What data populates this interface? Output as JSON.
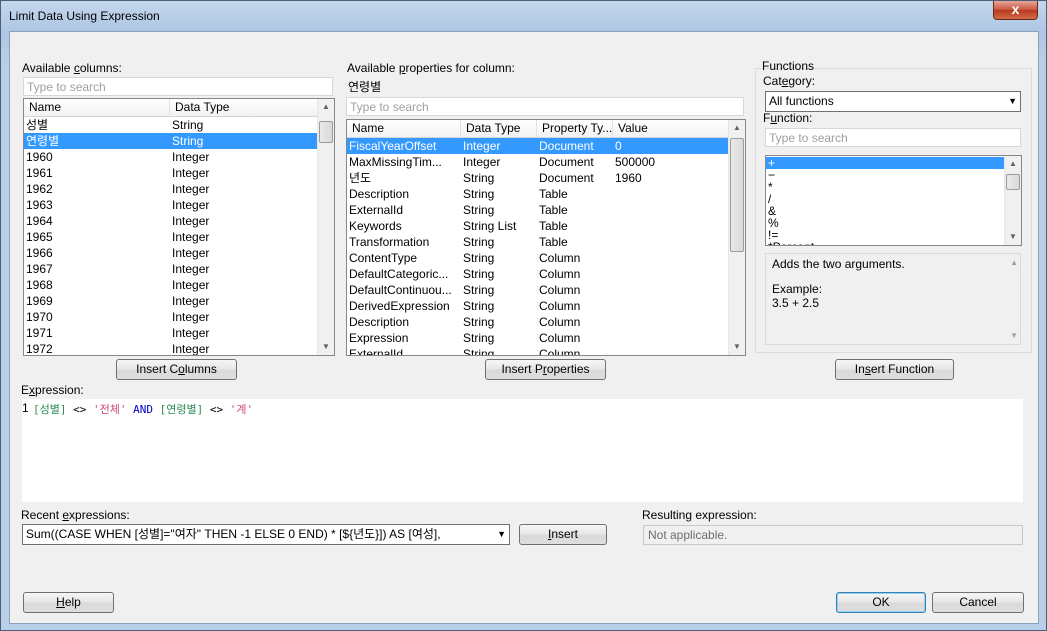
{
  "window": {
    "title": "Limit Data Using Expression",
    "close_glyph": "x"
  },
  "available_columns": {
    "label_pre": "Available ",
    "label_u": "c",
    "label_post": "olumns:",
    "search_placeholder": "Type to search",
    "headers": [
      "Name",
      "Data Type"
    ],
    "rows": [
      [
        "성별",
        "String"
      ],
      [
        "연령별",
        "String"
      ],
      [
        "1960",
        "Integer"
      ],
      [
        "1961",
        "Integer"
      ],
      [
        "1962",
        "Integer"
      ],
      [
        "1963",
        "Integer"
      ],
      [
        "1964",
        "Integer"
      ],
      [
        "1965",
        "Integer"
      ],
      [
        "1966",
        "Integer"
      ],
      [
        "1967",
        "Integer"
      ],
      [
        "1968",
        "Integer"
      ],
      [
        "1969",
        "Integer"
      ],
      [
        "1970",
        "Integer"
      ],
      [
        "1971",
        "Integer"
      ],
      [
        "1972",
        "Integer"
      ]
    ],
    "selected_index": 1,
    "insert_pre": "Insert C",
    "insert_u": "o",
    "insert_post": "lumns"
  },
  "available_properties": {
    "label_pre": "Available ",
    "label_u": "p",
    "label_post": "roperties for column:",
    "column_name": "연령별",
    "search_placeholder": "Type to search",
    "headers": [
      "Name",
      "Data Type",
      "Property Ty...",
      "Value"
    ],
    "rows": [
      [
        "FiscalYearOffset",
        "Integer",
        "Document",
        "0"
      ],
      [
        "MaxMissingTim...",
        "Integer",
        "Document",
        "500000"
      ],
      [
        "년도",
        "String",
        "Document",
        "1960"
      ],
      [
        "Description",
        "String",
        "Table",
        ""
      ],
      [
        "ExternalId",
        "String",
        "Table",
        ""
      ],
      [
        "Keywords",
        "String List",
        "Table",
        ""
      ],
      [
        "Transformation",
        "String",
        "Table",
        ""
      ],
      [
        "ContentType",
        "String",
        "Column",
        ""
      ],
      [
        "DefaultCategoric...",
        "String",
        "Column",
        ""
      ],
      [
        "DefaultContinuou...",
        "String",
        "Column",
        ""
      ],
      [
        "DerivedExpression",
        "String",
        "Column",
        ""
      ],
      [
        "Description",
        "String",
        "Column",
        ""
      ],
      [
        "Expression",
        "String",
        "Column",
        ""
      ],
      [
        "ExternalId",
        "String",
        "Column",
        ""
      ]
    ],
    "selected_index": 0,
    "insert_pre": "Insert P",
    "insert_u": "r",
    "insert_post": "operties"
  },
  "functions": {
    "group_label": "Functions",
    "category_label_pre": "Cat",
    "category_label_u": "e",
    "category_label_post": "gory:",
    "category_value": "All functions",
    "function_label_pre": "F",
    "function_label_u": "u",
    "function_label_post": "nction:",
    "search_placeholder": "Type to search",
    "items": [
      "+",
      "−",
      "*",
      "/",
      "&",
      "%",
      "!=",
      "*Percent"
    ],
    "selected_index": 0,
    "description": "Adds the two arguments.",
    "example_label": "Example:",
    "example_value": "3.5 + 2.5",
    "insert_pre": "In",
    "insert_u": "s",
    "insert_post": "ert Function"
  },
  "expression": {
    "label_pre": "E",
    "label_u": "x",
    "label_post": "pression:",
    "line_number": "1",
    "tokens": [
      {
        "t": "[성별]",
        "c": "c-br"
      },
      {
        "t": " <> ",
        "c": "c-op"
      },
      {
        "t": "'전체'",
        "c": "c-str"
      },
      {
        "t": " AND ",
        "c": "c-kw"
      },
      {
        "t": "[연령별]",
        "c": "c-br"
      },
      {
        "t": " <> ",
        "c": "c-op"
      },
      {
        "t": "'계'",
        "c": "c-str"
      }
    ]
  },
  "recent": {
    "label_pre": "Recent ",
    "label_u": "e",
    "label_post": "xpressions:",
    "value": "Sum((CASE  WHEN [성별]=\"여자\" THEN -1 ELSE 0 END) * [${년도}]) AS [여성],",
    "insert_label_u": "I",
    "insert_label_post": "nsert"
  },
  "resulting": {
    "label": "Resulting expression:",
    "value": "Not applicable."
  },
  "footer": {
    "help_u": "H",
    "help_post": "elp",
    "ok": "OK",
    "cancel": "Cancel"
  }
}
